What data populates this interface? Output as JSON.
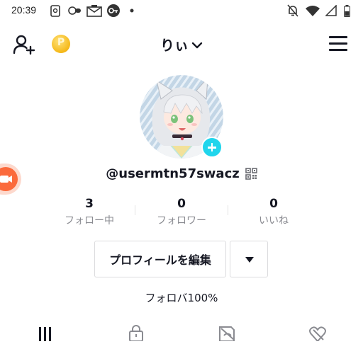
{
  "status_bar": {
    "time": "20:39",
    "left_icons": [
      "sim-card-icon",
      "vpn-key-icon",
      "news-icon",
      "key-icon",
      "dot-icon"
    ],
    "right_icons": [
      "mute-bell-icon",
      "wifi-icon",
      "signal-icon",
      "battery-icon"
    ]
  },
  "header": {
    "username": "りぃ",
    "coin_label": "P",
    "icons": [
      "add-friend-icon",
      "coin-icon",
      "chevron-down-icon",
      "menu-icon"
    ]
  },
  "profile": {
    "handle": "@usermtn57swacz",
    "stats": [
      {
        "count": "3",
        "label": "フォロー中"
      },
      {
        "count": "0",
        "label": "フォロワー"
      },
      {
        "count": "0",
        "label": "いいね"
      }
    ],
    "edit_button": "プロフィールを編集",
    "bio": "フォロバ100%"
  },
  "tabs": [
    "videos-grid-icon",
    "private-lock-icon",
    "hidden-likes-icon",
    "liked-heart-icon"
  ],
  "colors": {
    "accent_cyan": "#20d5ec",
    "live_orange": "#fb6a3c",
    "coin_gold": "#f5b818",
    "text_primary": "#161823",
    "text_secondary": "#8a8b91"
  }
}
